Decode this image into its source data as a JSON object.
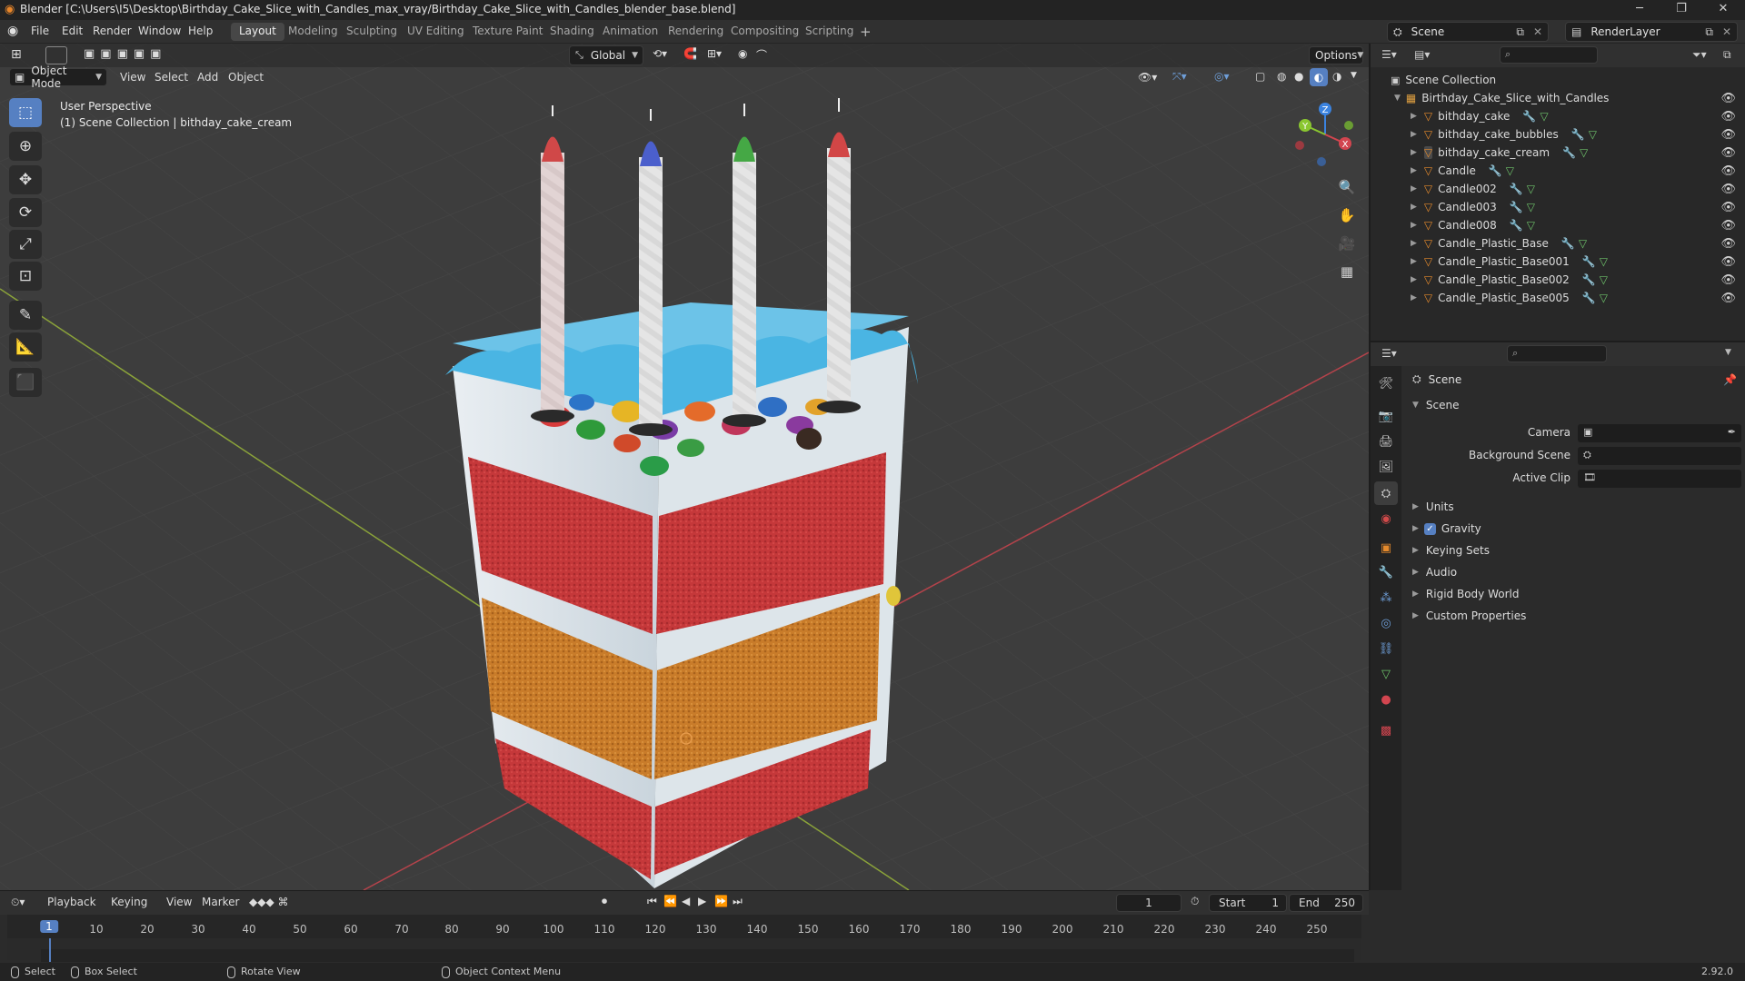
{
  "window": {
    "title": "Blender [C:\\Users\\I5\\Desktop\\Birthday_Cake_Slice_with_Candles_max_vray/Birthday_Cake_Slice_with_Candles_blender_base.blend]"
  },
  "menubar": {
    "items": [
      "File",
      "Edit",
      "Render",
      "Window",
      "Help"
    ],
    "workspaces": [
      "Layout",
      "Modeling",
      "Sculpting",
      "UV Editing",
      "Texture Paint",
      "Shading",
      "Animation",
      "Rendering",
      "Compositing",
      "Scripting"
    ],
    "active_workspace": "Layout",
    "scene": "Scene",
    "view_layer": "RenderLayer"
  },
  "viewport": {
    "mode": "Object Mode",
    "menus": [
      "View",
      "Select",
      "Add",
      "Object"
    ],
    "transform_orientation": "Global",
    "options_label": "Options",
    "overlay_line1": "User Perspective",
    "overlay_line2": "(1) Scene Collection | bithday_cake_cream",
    "gizmo": {
      "x": "X",
      "y": "Y",
      "z": "Z"
    }
  },
  "outliner": {
    "root": "Scene Collection",
    "collection": "Birthday_Cake_Slice_with_Candles",
    "objects": [
      "bithday_cake",
      "bithday_cake_bubbles",
      "bithday_cake_cream",
      "Candle",
      "Candle002",
      "Candle003",
      "Candle008",
      "Candle_Plastic_Base",
      "Candle_Plastic_Base001",
      "Candle_Plastic_Base002",
      "Candle_Plastic_Base005"
    ]
  },
  "properties": {
    "context": "Scene",
    "panel": "Scene",
    "fields": {
      "camera_label": "Camera",
      "background_label": "Background Scene",
      "clip_label": "Active Clip"
    },
    "sections": [
      "Units",
      "Gravity",
      "Keying Sets",
      "Audio",
      "Rigid Body World",
      "Custom Properties"
    ],
    "gravity_checked": true
  },
  "timeline": {
    "menus": [
      "Playback",
      "Keying",
      "View",
      "Marker"
    ],
    "current_frame": "1",
    "start_label": "Start",
    "start": "1",
    "end_label": "End",
    "end": "250",
    "ticks": [
      "1",
      "10",
      "20",
      "30",
      "40",
      "50",
      "60",
      "70",
      "80",
      "90",
      "100",
      "110",
      "120",
      "130",
      "140",
      "150",
      "160",
      "170",
      "180",
      "190",
      "200",
      "210",
      "220",
      "230",
      "240",
      "250"
    ]
  },
  "statusbar": {
    "select": "Select",
    "box_select": "Box Select",
    "rotate": "Rotate View",
    "context_menu": "Object Context Menu",
    "version": "2.92.0"
  },
  "colors": {
    "accent": "#5680c2",
    "mesh_icon": "#e58a2c",
    "x_axis": "#d2454f",
    "y_axis": "#8ac630",
    "z_axis": "#3b83e0"
  }
}
